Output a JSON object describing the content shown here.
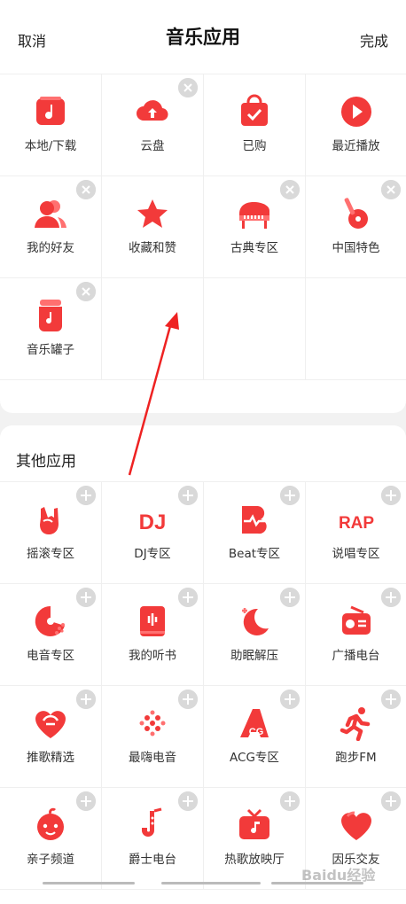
{
  "header": {
    "cancel": "取消",
    "title": "音乐应用",
    "done": "完成"
  },
  "my_apps": [
    {
      "label": "本地/下载",
      "icon": "music-folder-icon",
      "removable": false
    },
    {
      "label": "云盘",
      "icon": "cloud-upload-icon",
      "removable": true
    },
    {
      "label": "已购",
      "icon": "shopping-bag-check-icon",
      "removable": false
    },
    {
      "label": "最近播放",
      "icon": "play-circle-icon",
      "removable": false
    },
    {
      "label": "我的好友",
      "icon": "friends-icon",
      "removable": true
    },
    {
      "label": "收藏和赞",
      "icon": "star-icon",
      "removable": false
    },
    {
      "label": "古典专区",
      "icon": "piano-icon",
      "removable": true
    },
    {
      "label": "中国特色",
      "icon": "pipa-icon",
      "removable": true
    },
    {
      "label": "音乐罐子",
      "icon": "music-jar-icon",
      "removable": true
    }
  ],
  "other_section": {
    "title": "其他应用"
  },
  "other_apps": [
    {
      "label": "摇滚专区",
      "icon": "rock-hand-icon"
    },
    {
      "label": "DJ专区",
      "icon": "dj-icon"
    },
    {
      "label": "Beat专区",
      "icon": "beat-icon"
    },
    {
      "label": "说唱专区",
      "icon": "rap-icon"
    },
    {
      "label": "电音专区",
      "icon": "electronic-disc-icon"
    },
    {
      "label": "我的听书",
      "icon": "audiobook-icon"
    },
    {
      "label": "助眠解压",
      "icon": "moon-icon"
    },
    {
      "label": "广播电台",
      "icon": "radio-icon"
    },
    {
      "label": "推歌精选",
      "icon": "recommend-heart-icon"
    },
    {
      "label": "最嗨电音",
      "icon": "dot-matrix-icon"
    },
    {
      "label": "ACG专区",
      "icon": "acg-icon"
    },
    {
      "label": "跑步FM",
      "icon": "runner-icon"
    },
    {
      "label": "亲子频道",
      "icon": "kid-face-icon"
    },
    {
      "label": "爵士电台",
      "icon": "saxophone-icon"
    },
    {
      "label": "热歌放映厅",
      "icon": "tv-music-icon"
    },
    {
      "label": "因乐交友",
      "icon": "music-heart-icon"
    }
  ],
  "colors": {
    "accent": "#f23a3a",
    "accent_light": "#ff6b6b",
    "badge": "#d9d9d9"
  },
  "watermark": "Baidu经验"
}
